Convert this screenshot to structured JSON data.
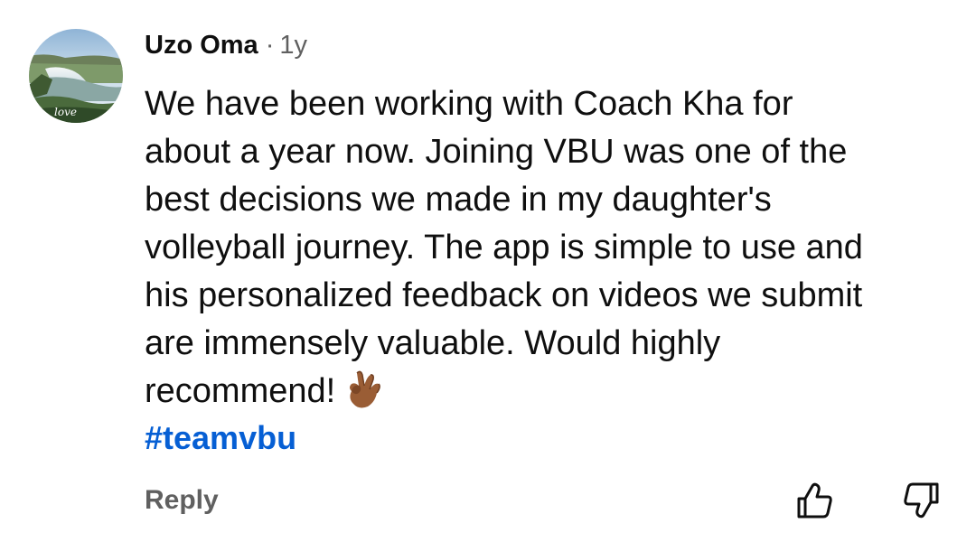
{
  "comment": {
    "author": "Uzo Oma",
    "separator": "·",
    "age": "1y",
    "avatar_icon": "avatar-waterfall-image",
    "avatar_caption": "love",
    "body_lines": [
      "We have been working with Coach Kha for",
      "about a year now. Joining VBU was one of the",
      "best decisions we made in my daughter's",
      "volleyball journey. The app is simple to use and",
      "his personalized feedback on videos we submit",
      "are immensely valuable. Would highly",
      "recommend!"
    ],
    "emoji": "ok-hand-medium-dark-skin-tone",
    "hashtag": "#teamvbu",
    "reply_label": "Reply",
    "like_icon": "thumbs-up-icon",
    "dislike_icon": "thumbs-down-icon"
  },
  "colors": {
    "text": "#0f0f0f",
    "secondary": "#606060",
    "link": "#065fd4",
    "background": "#ffffff"
  }
}
